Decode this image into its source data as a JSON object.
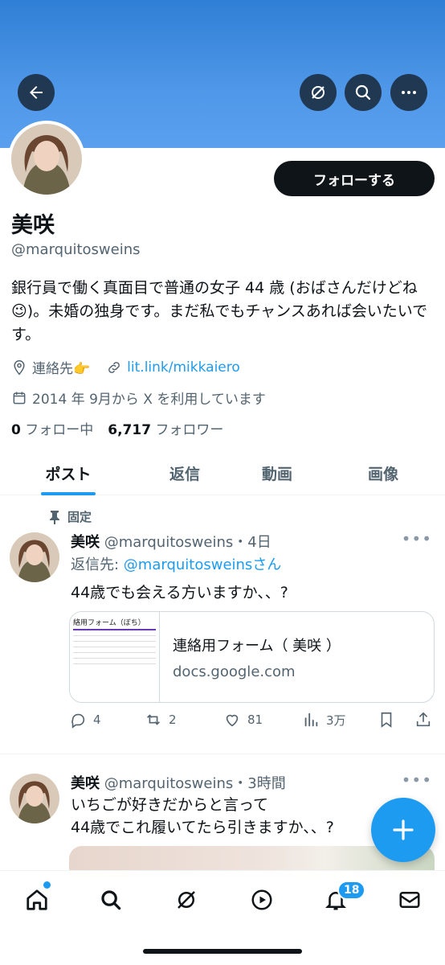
{
  "header": {
    "back_icon": "arrow-left-icon",
    "icons": [
      "grok-icon",
      "search-icon",
      "more-icon"
    ]
  },
  "profile": {
    "follow_label": "フォローする",
    "name": "美咲",
    "handle": "@marquitosweins",
    "bio": "銀行員で働く真面目で普通の女子 44 歳 (おばさんだけどね😉)。未婚の独身です。まだ私でもチャンスあれば会いたいです。",
    "location": "連絡先👉",
    "link": "lit.link/mikkaiero",
    "joined": "2014 年 9月から X を利用しています",
    "following_count": "0",
    "following_label": "フォロー中",
    "followers_count": "6,717",
    "followers_label": "フォロワー"
  },
  "tabs": [
    "ポスト",
    "返信",
    "動画",
    "画像"
  ],
  "pinned_label": "固定",
  "posts": [
    {
      "name": "美咲",
      "handle_time": "@marquitosweins・4日",
      "reply_prefix": "返信先: ",
      "reply_to": "@marquitosweinsさん",
      "text": "44歳でも会える方いますか、、?",
      "card": {
        "title": "連絡用フォーム（ 美咲 ）",
        "url": "docs.google.com",
        "thumb_title": "絡用フォーム（ぼち）"
      },
      "replies": "4",
      "reposts": "2",
      "likes": "81",
      "views": "3万"
    },
    {
      "name": "美咲",
      "handle_time": "@marquitosweins・3時間",
      "text_line1": "いちごが好きだからと言って",
      "text_line2": "44歳でこれ履いてたら引きますか、、?"
    }
  ],
  "nav": {
    "items": [
      "home-icon",
      "search-icon",
      "grok-icon",
      "video-icon",
      "notifications-icon",
      "messages-icon"
    ],
    "notif_badge": "18"
  },
  "colors": {
    "accent": "#1d9bf0",
    "banner": "#4f97e8",
    "text": "#0f1419",
    "muted": "#536471"
  }
}
